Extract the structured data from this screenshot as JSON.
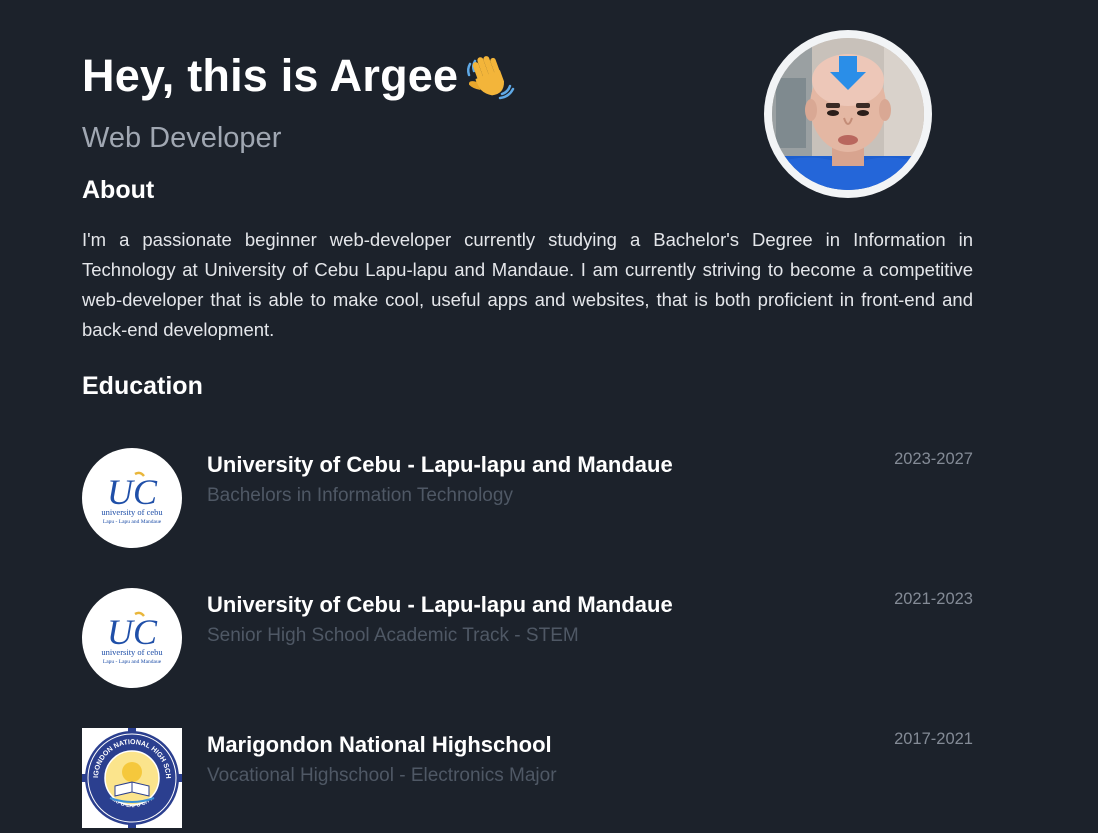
{
  "hero": {
    "title": "Hey, this is Argee",
    "wave_icon": "waving-hand-icon",
    "subtitle": "Web Developer"
  },
  "avatar": {
    "icon": "profile-photo"
  },
  "about": {
    "heading": "About",
    "text": "I'm a passionate beginner web-developer currently studying a Bachelor's Degree in Information in Technology at University of Cebu Lapu-lapu and Mandaue. I am currently striving to become a competitive web-developer that is able to make cool, useful apps and websites, that is both proficient in front-end and back-end development."
  },
  "education": {
    "heading": "Education",
    "items": [
      {
        "school": "University of Cebu - Lapu-lapu and Mandaue",
        "program": "Bachelors in Information Technology",
        "years": "2023-2027",
        "logo": {
          "mark": "UC",
          "line1": "university of cebu",
          "line2": "Lapu - Lapu and Mandaue"
        }
      },
      {
        "school": "University of Cebu - Lapu-lapu and Mandaue",
        "program": "Senior High School Academic Track - STEM",
        "years": "2021-2023",
        "logo": {
          "mark": "UC",
          "line1": "university of cebu",
          "line2": "Lapu - Lapu and Mandaue"
        }
      },
      {
        "school": "Marigondon National Highschool",
        "program": "Vocational Highschool - Electronics Major",
        "years": "2017-2021",
        "logo": {
          "ring_top": "MARIGONDON NATIONAL HIGH SCHOOL",
          "ring_bottom": "LAPU-LAPU CITY"
        }
      }
    ]
  },
  "colors": {
    "background": "#1c222b",
    "subtitle": "#a0a7b2",
    "program": "#4f5865",
    "years": "#848b96",
    "uc_blue": "#1f4fa8",
    "uc_gold": "#e9b63a"
  }
}
